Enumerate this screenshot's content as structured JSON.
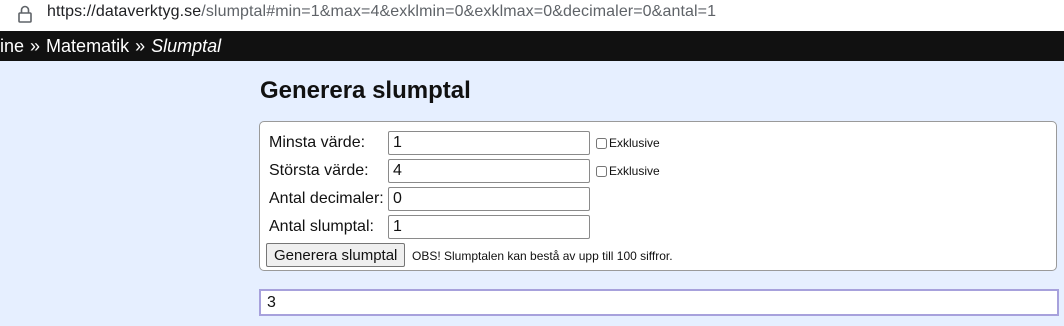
{
  "browser": {
    "url_host": "https://dataverktyg.se",
    "url_path": "/slumptal#min=1&max=4&exklmin=0&exklmax=0&decimaler=0&antal=1",
    "lock_icon": "lock-icon"
  },
  "breadcrumb": {
    "items": [
      "ine",
      "Matematik",
      "Slumptal"
    ],
    "separator": "»"
  },
  "page": {
    "title": "Generera slumptal"
  },
  "form": {
    "min_label": "Minsta värde:",
    "min_value": "1",
    "max_label": "Största värde:",
    "max_value": "4",
    "decimals_label": "Antal decimaler:",
    "decimals_value": "0",
    "count_label": "Antal slumptal:",
    "count_value": "1",
    "exclusive_label": "Exklusive",
    "min_exclusive": false,
    "max_exclusive": false,
    "generate_button": "Generera slumptal",
    "note": "OBS! Slumptalen kan bestå av upp till 100 siffror."
  },
  "result": {
    "value": "3"
  },
  "colors": {
    "page_background": "#e6efff",
    "breadcrumb_background": "#111111",
    "result_border": "#a7a1dc"
  }
}
